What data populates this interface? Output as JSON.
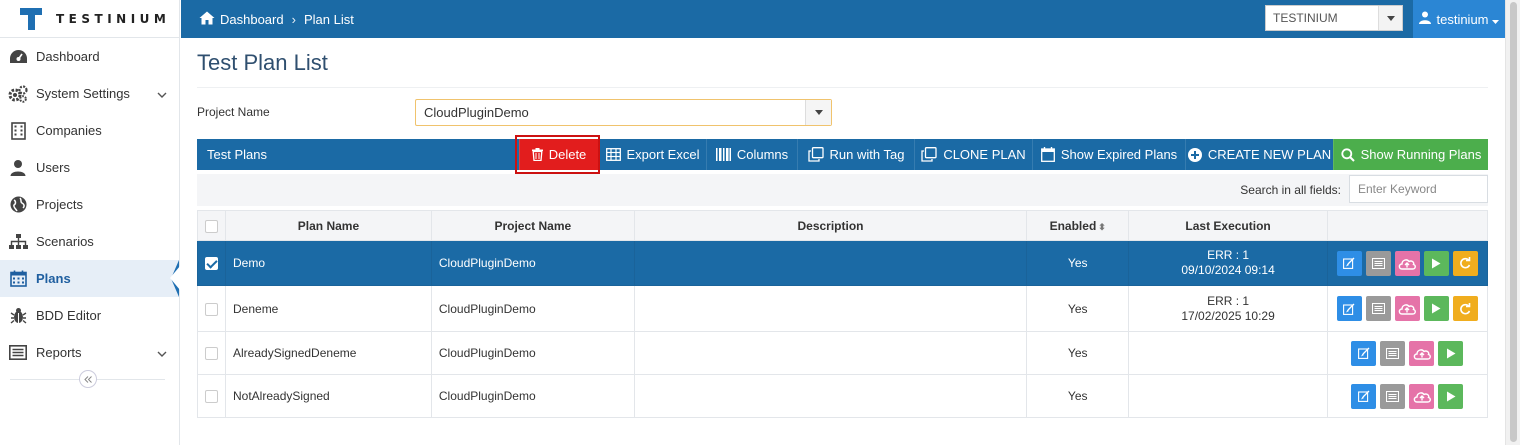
{
  "app": {
    "logo_text": "TESTINIUM"
  },
  "breadcrumb": {
    "home": "Dashboard",
    "current": "Plan List"
  },
  "company_select": {
    "value": "TESTINIUM"
  },
  "user_menu": {
    "label": "testinium"
  },
  "sidebar": {
    "items": [
      {
        "label": "Dashboard",
        "icon": "dashboard-icon",
        "has_chevron": false
      },
      {
        "label": "System Settings",
        "icon": "cogs-icon",
        "has_chevron": true
      },
      {
        "label": "Companies",
        "icon": "building-icon",
        "has_chevron": false
      },
      {
        "label": "Users",
        "icon": "user-icon",
        "has_chevron": false
      },
      {
        "label": "Projects",
        "icon": "globe-icon",
        "has_chevron": false
      },
      {
        "label": "Scenarios",
        "icon": "sitemap-icon",
        "has_chevron": false
      },
      {
        "label": "Plans",
        "icon": "calendar-icon",
        "has_chevron": false,
        "active": true
      },
      {
        "label": "BDD Editor",
        "icon": "bug-icon",
        "has_chevron": false
      },
      {
        "label": "Reports",
        "icon": "list-icon",
        "has_chevron": true
      }
    ]
  },
  "page": {
    "title": "Test Plan List",
    "project_label": "Project Name",
    "project_value": "CloudPluginDemo"
  },
  "toolbar": {
    "title": "Test Plans",
    "delete": "Delete",
    "export_excel": "Export Excel",
    "columns": "Columns",
    "run_with_tag": "Run with Tag",
    "clone_plan": "CLONE PLAN",
    "show_expired": "Show Expired Plans",
    "create_new": "CREATE NEW PLAN",
    "show_running": "Show Running Plans"
  },
  "search": {
    "label": "Search in all fields:",
    "placeholder": "Enter Keyword"
  },
  "table": {
    "headers": [
      "Plan Name",
      "Project Name",
      "Description",
      "Enabled",
      "Last Execution"
    ],
    "rows": [
      {
        "plan_name": "Demo",
        "project_name": "CloudPluginDemo",
        "description": "",
        "enabled": "Yes",
        "exec_status": "ERR : 1",
        "exec_date": "09/10/2024 09:14",
        "selected": true
      },
      {
        "plan_name": "Deneme",
        "project_name": "CloudPluginDemo",
        "description": "",
        "enabled": "Yes",
        "exec_status": "ERR : 1",
        "exec_date": "17/02/2025 10:29",
        "selected": false
      },
      {
        "plan_name": "AlreadySignedDeneme",
        "project_name": "CloudPluginDemo",
        "description": "",
        "enabled": "Yes",
        "exec_status": "",
        "exec_date": "",
        "selected": false
      },
      {
        "plan_name": "NotAlreadySigned",
        "project_name": "CloudPluginDemo",
        "description": "",
        "enabled": "Yes",
        "exec_status": "",
        "exec_date": "",
        "selected": false
      }
    ]
  },
  "colors": {
    "primary": "#1b6aa5",
    "danger": "#e21d1d",
    "success": "#4cae4c",
    "edit": "#2e8ee6",
    "cloud": "#e573a8",
    "run": "#5cb85c",
    "refresh": "#f0ad1e"
  }
}
